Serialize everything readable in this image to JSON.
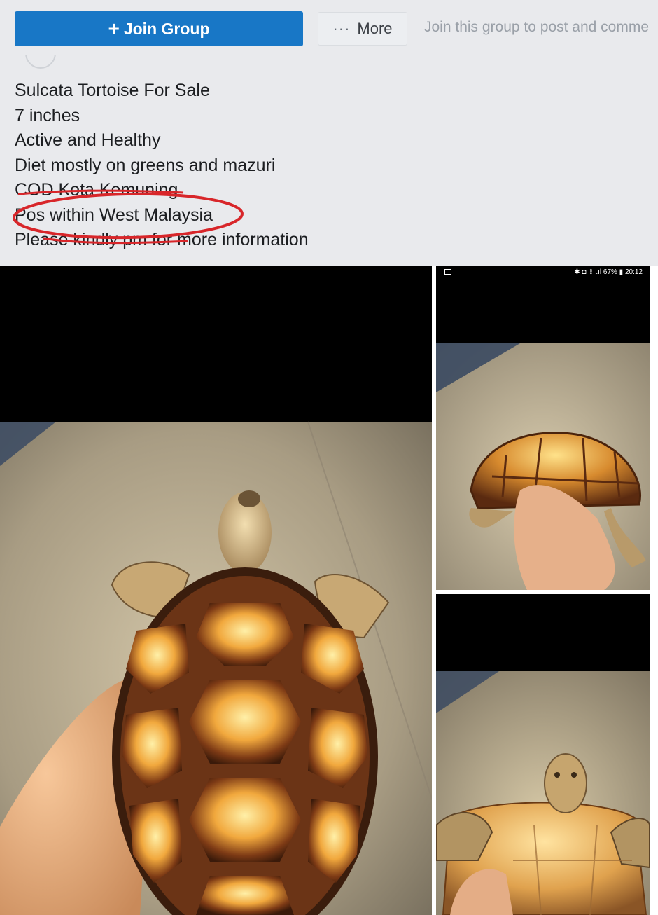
{
  "header": {
    "join_button_icon": "+",
    "join_button_label": "Join Group",
    "more_button_icon": "···",
    "more_button_label": "More",
    "join_hint": "Join this group to post and comme"
  },
  "post": {
    "lines": [
      "Sulcata Tortoise For Sale",
      "7 inches",
      "Active and Healthy",
      "Diet mostly on greens and mazuri",
      "COD Kota Kemuning",
      "Pos within West Malaysia",
      "Please kindly pm for more information"
    ]
  },
  "photos": {
    "status_bar_text": "✱ ◘ ⇪ .ıl 67% ▮ 20:12"
  },
  "colors": {
    "accent": "#1877c6",
    "annotation": "#d8262a",
    "background": "#e9eaed"
  }
}
